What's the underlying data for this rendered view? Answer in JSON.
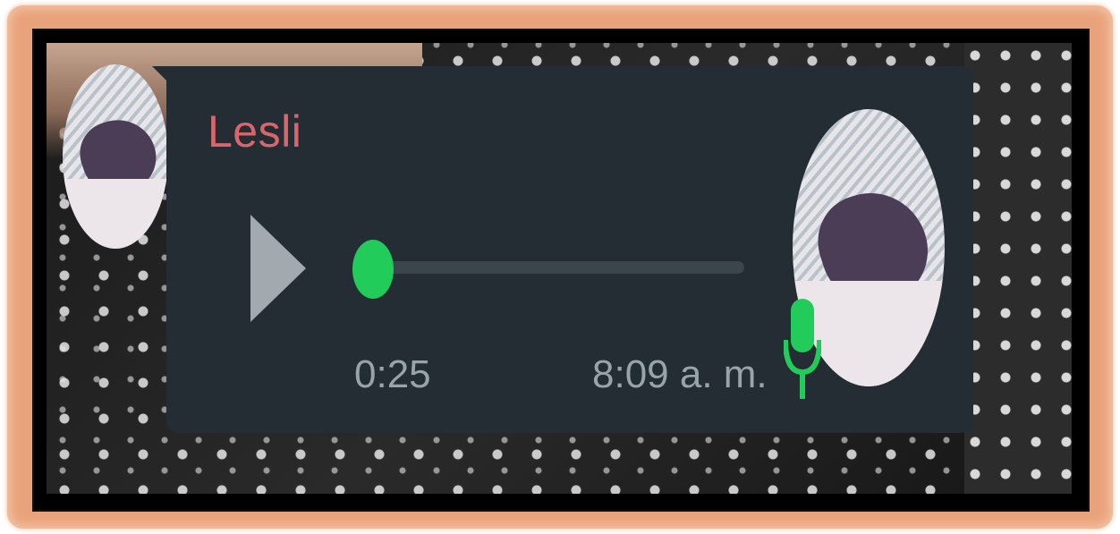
{
  "message": {
    "sender_name": "Lesli",
    "duration": "0:25",
    "timestamp": "8:09 a. m.",
    "progress": 0
  },
  "icons": {
    "play": "play-icon",
    "mic": "microphone-icon"
  },
  "colors": {
    "sender_name": "#d9666c",
    "accent_green": "#22cc5a",
    "bubble_bg": "#232d33",
    "meta_text": "#98a3aa",
    "frame_border": "#e9a37c"
  }
}
